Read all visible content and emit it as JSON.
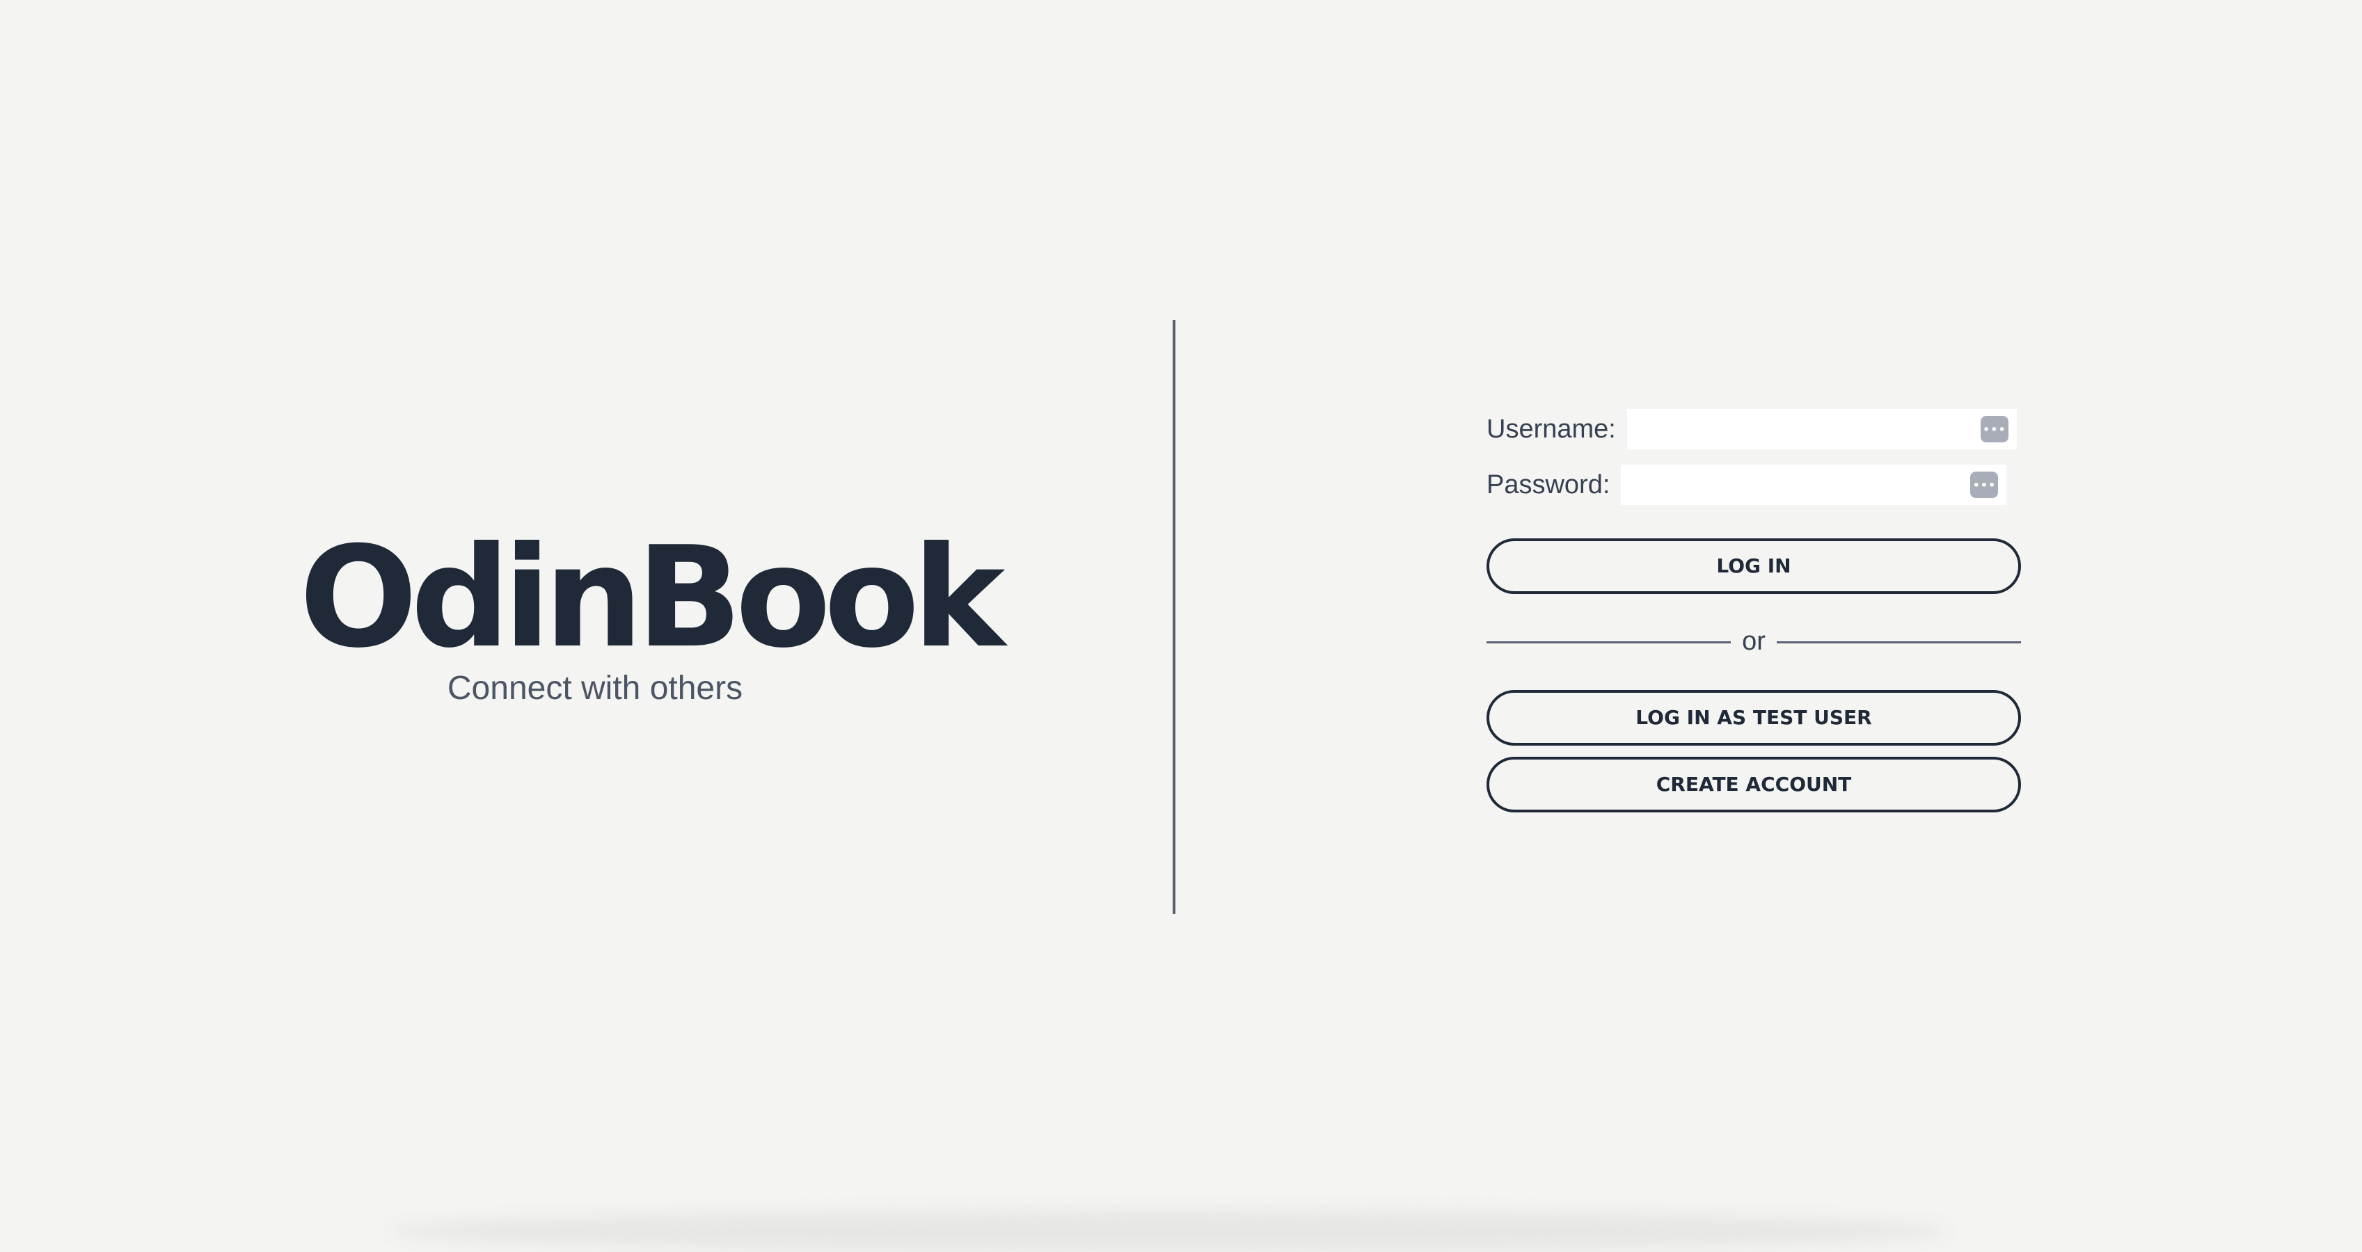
{
  "brand": {
    "title": "OdinBook",
    "tagline": "Connect with others"
  },
  "login_form": {
    "username_label": "Username:",
    "username_value": "",
    "password_label": "Password:",
    "password_value": "",
    "autofill_icon": "password-autofill-icon",
    "login_button": "LOG IN",
    "separator_text": "or",
    "test_user_button": "LOG IN AS TEST USER",
    "create_account_button": "CREATE ACCOUNT"
  },
  "colors": {
    "background": "#f4f4f2",
    "text": "#1f2937",
    "muted_text": "#4b5563",
    "divider": "#5a6170",
    "button_border": "#1f2937",
    "autofill_icon_bg": "#a8adb7"
  }
}
